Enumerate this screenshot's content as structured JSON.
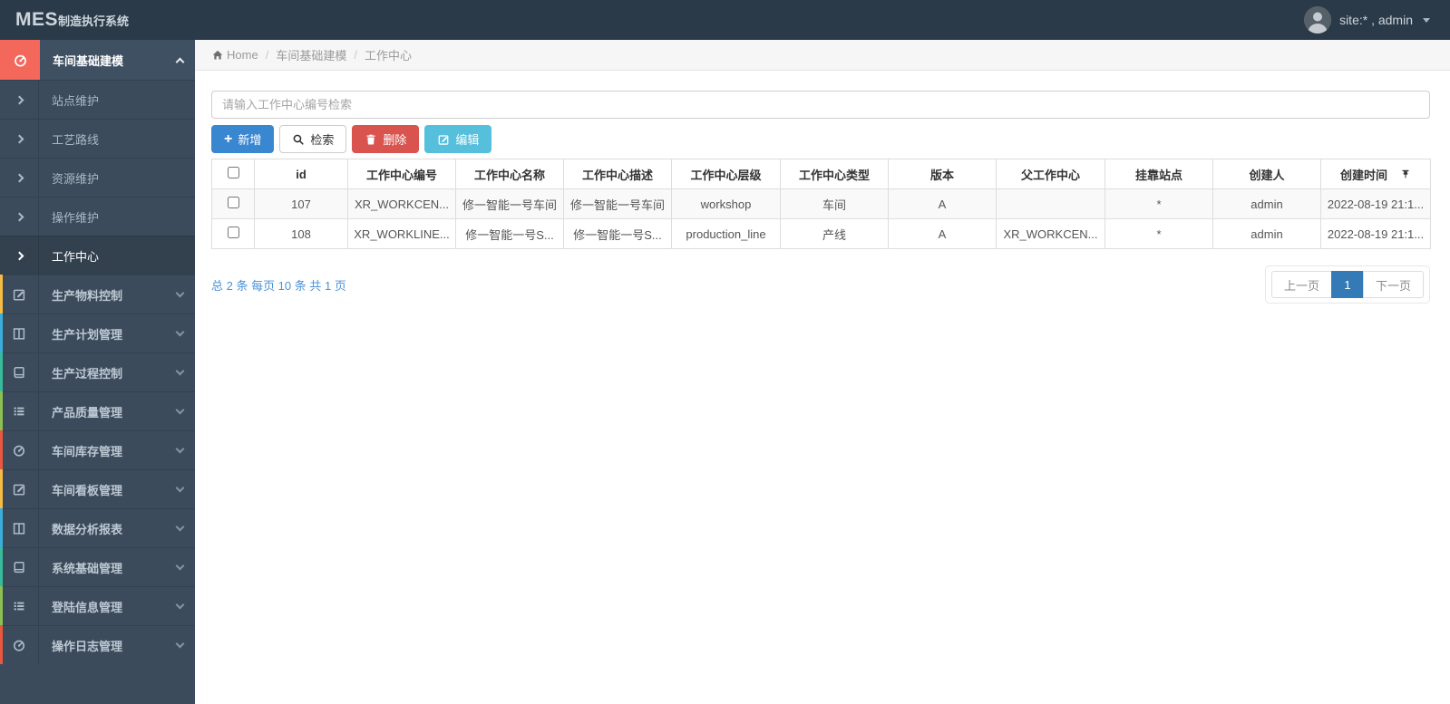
{
  "topbar": {
    "brand_bold": "MES",
    "brand_rest": "制造执行系统",
    "user_label": "site:* , admin"
  },
  "breadcrumb": {
    "home": "Home",
    "sep": "/",
    "level1": "车间基础建模",
    "level2": "工作中心"
  },
  "sidebar": {
    "active_group": {
      "label": "车间基础建模",
      "icon": "gauge-icon",
      "accent": "#f4685c"
    },
    "submenu": [
      {
        "label": "站点维护"
      },
      {
        "label": "工艺路线"
      },
      {
        "label": "资源维护"
      },
      {
        "label": "操作维护"
      },
      {
        "label": "工作中心"
      }
    ],
    "groups": [
      {
        "label": "生产物料控制",
        "icon": "edit-square-icon",
        "color": "#f6bb42"
      },
      {
        "label": "生产计划管理",
        "icon": "columns-icon",
        "color": "#3bafda"
      },
      {
        "label": "生产过程控制",
        "icon": "book-icon",
        "color": "#37bc9b"
      },
      {
        "label": "产品质量管理",
        "icon": "list-icon",
        "color": "#8cc152"
      },
      {
        "label": "车间库存管理",
        "icon": "gauge-icon",
        "color": "#e9573f"
      },
      {
        "label": "车间看板管理",
        "icon": "edit-square-icon",
        "color": "#f6bb42"
      },
      {
        "label": "数据分析报表",
        "icon": "columns-icon",
        "color": "#3bafda"
      },
      {
        "label": "系统基础管理",
        "icon": "book-icon",
        "color": "#37bc9b"
      },
      {
        "label": "登陆信息管理",
        "icon": "list-icon",
        "color": "#8cc152"
      },
      {
        "label": "操作日志管理",
        "icon": "gauge-icon",
        "color": "#e9573f"
      }
    ]
  },
  "toolbar": {
    "search_placeholder": "请输入工作中心编号检索",
    "add_label": "新增",
    "search_label": "检索",
    "delete_label": "删除",
    "edit_label": "编辑",
    "colors": {
      "add": "#3a87d1",
      "delete": "#d9534f",
      "edit": "#56bfdc"
    }
  },
  "table": {
    "columns": [
      "id",
      "工作中心编号",
      "工作中心名称",
      "工作中心描述",
      "工作中心层级",
      "工作中心类型",
      "版本",
      "父工作中心",
      "挂靠站点",
      "创建人",
      "创建时间"
    ],
    "rows": [
      {
        "cells": [
          "107",
          "XR_WORKCEN...",
          "修一智能一号车间",
          "修一智能一号车间",
          "workshop",
          "车间",
          "A",
          "",
          "*",
          "admin",
          "2022-08-19 21:1..."
        ]
      },
      {
        "cells": [
          "108",
          "XR_WORKLINE...",
          "修一智能一号S...",
          "修一智能一号S...",
          "production_line",
          "产线",
          "A",
          "XR_WORKCEN...",
          "*",
          "admin",
          "2022-08-19 21:1..."
        ]
      }
    ]
  },
  "pagination": {
    "summary": "总 2 条 每页 10 条 共 1 页",
    "prev_label": "上一页",
    "current_page": "1",
    "next_label": "下一页",
    "active_color": "#337ab7"
  }
}
